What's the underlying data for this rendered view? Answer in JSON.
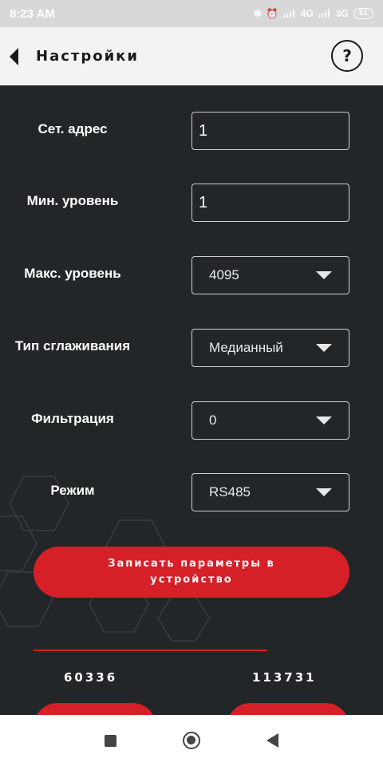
{
  "status_bar": {
    "time": "8:23 AM",
    "network_1": "4G",
    "network_2": "3G",
    "battery": "51"
  },
  "app_bar": {
    "title": "Настройки",
    "help_label": "?"
  },
  "settings": {
    "net_address": {
      "label": "Сет. адрес",
      "value": "1"
    },
    "min_level": {
      "label": "Мин. уровень",
      "value": "1"
    },
    "max_level": {
      "label": "Макс. уровень",
      "value": "4095"
    },
    "smoothing_type": {
      "label": "Тип сглаживания",
      "value": "Медианный"
    },
    "filtration": {
      "label": "Фильтрация",
      "value": "0"
    },
    "mode": {
      "label": "Режим",
      "value": "RS485"
    }
  },
  "write_button_label": "Записать параметры в устройство",
  "counters": {
    "left": "60336",
    "right": "113731"
  },
  "colors": {
    "accent": "#d42026",
    "background": "#232628",
    "appbar": "#f3f3f3"
  }
}
